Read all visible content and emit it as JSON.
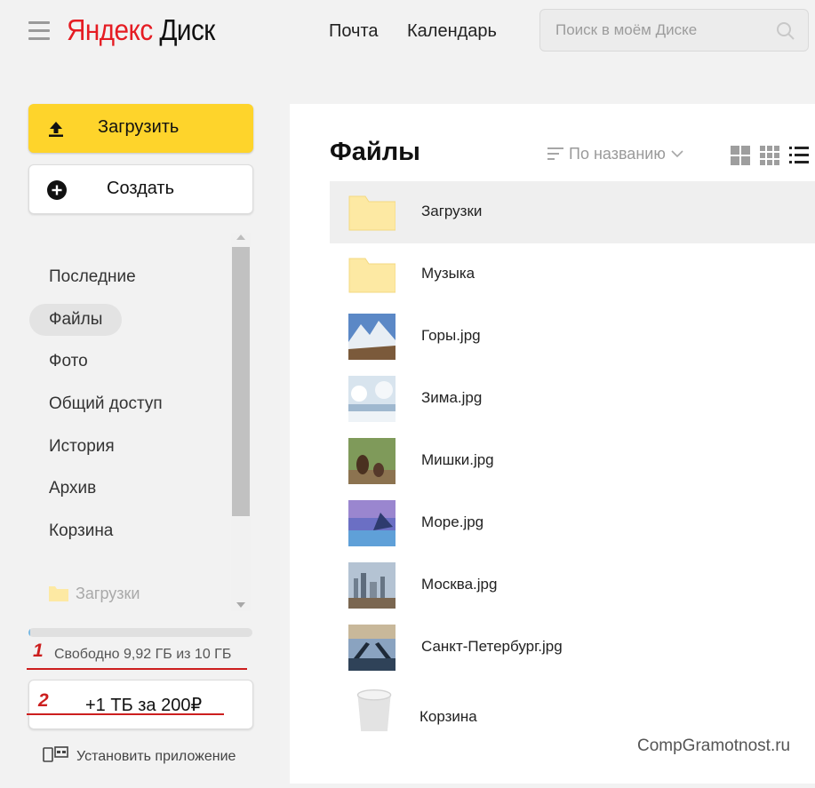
{
  "header": {
    "logo_yandex": "Яндекс",
    "logo_disk": "Диск",
    "links": [
      "Почта",
      "Календарь"
    ],
    "search_placeholder": "Поиск в моём Диске"
  },
  "sidebar": {
    "upload_label": "Загрузить",
    "create_label": "Создать",
    "nav": [
      {
        "label": "Последние",
        "active": false
      },
      {
        "label": "Файлы",
        "active": true
      },
      {
        "label": "Фото",
        "active": false
      },
      {
        "label": "Общий доступ",
        "active": false
      },
      {
        "label": "История",
        "active": false
      },
      {
        "label": "Архив",
        "active": false
      },
      {
        "label": "Корзина",
        "active": false
      }
    ],
    "pinned_folder": "Загрузки",
    "storage": {
      "text": "Свободно 9,92 ГБ из 10 ГБ",
      "used_fraction": 0.008
    },
    "buy_label": "+1 ТБ за 200₽",
    "install_label": "Установить приложение",
    "annotations": [
      "1",
      "2"
    ]
  },
  "main": {
    "title": "Файлы",
    "sort_label": "По названию",
    "files": [
      {
        "name": "Загрузки",
        "kind": "folder",
        "selected": true
      },
      {
        "name": "Музыка",
        "kind": "folder",
        "selected": false
      },
      {
        "name": "Горы.jpg",
        "kind": "image-mountains",
        "selected": false
      },
      {
        "name": "Зима.jpg",
        "kind": "image-winter",
        "selected": false
      },
      {
        "name": "Мишки.jpg",
        "kind": "image-bears",
        "selected": false
      },
      {
        "name": "Море.jpg",
        "kind": "image-sea",
        "selected": false
      },
      {
        "name": "Москва.jpg",
        "kind": "image-moscow",
        "selected": false
      },
      {
        "name": "Санкт-Петербург.jpg",
        "kind": "image-spb",
        "selected": false
      },
      {
        "name": "Корзина",
        "kind": "trash",
        "selected": false
      }
    ]
  },
  "watermark": "CompGramotnost.ru",
  "colors": {
    "accent_yellow": "#fed42b",
    "logo_red": "#e51c23",
    "annotation_red": "#cc1e1e",
    "folder_yellow": "#fde9a3"
  }
}
